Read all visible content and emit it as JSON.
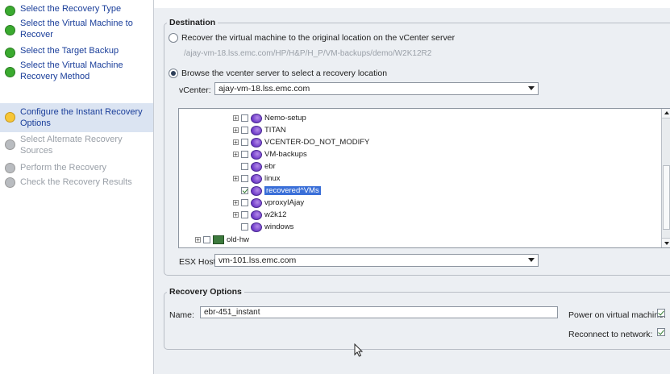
{
  "wizard": {
    "steps": [
      {
        "label": "Select the Recovery Type",
        "state": "done"
      },
      {
        "label": "Select the Virtual Machine to Recover",
        "state": "done"
      },
      {
        "label": "Select the Target Backup",
        "state": "done"
      },
      {
        "label": "Select the Virtual Machine Recovery Method",
        "state": "done"
      },
      {
        "label": "Configure the Instant Recovery Options",
        "state": "current"
      },
      {
        "label": "Select Alternate Recovery Sources",
        "state": "todo"
      },
      {
        "label": "Perform the Recovery",
        "state": "todo"
      },
      {
        "label": "Check the Recovery Results",
        "state": "todo"
      }
    ]
  },
  "destination": {
    "title": "Destination",
    "radio_original": "Recover the virtual machine to the original location on the vCenter server",
    "original_path": "/ajay-vm-18.lss.emc.com/HP/H&P/H_P/VM-backups/demo/W2K12R2",
    "radio_browse": "Browse the vcenter server to select a recovery location",
    "vcenter_label": "vCenter:",
    "vcenter_value": "ajay-vm-18.lss.emc.com",
    "tree": [
      {
        "label": "Nemo-setup",
        "expandable": true,
        "checked": false,
        "selected": false
      },
      {
        "label": "TITAN",
        "expandable": true,
        "checked": false,
        "selected": false
      },
      {
        "label": "VCENTER-DO_NOT_MODIFY",
        "expandable": true,
        "checked": false,
        "selected": false
      },
      {
        "label": "VM-backups",
        "expandable": true,
        "checked": false,
        "selected": false
      },
      {
        "label": "ebr",
        "expandable": false,
        "checked": false,
        "selected": false
      },
      {
        "label": "linux",
        "expandable": true,
        "checked": false,
        "selected": false
      },
      {
        "label": "recovered^VMs",
        "expandable": false,
        "checked": true,
        "selected": true
      },
      {
        "label": "vproxyIAjay",
        "expandable": true,
        "checked": false,
        "selected": false
      },
      {
        "label": "w2k12",
        "expandable": true,
        "checked": false,
        "selected": false
      },
      {
        "label": "windows",
        "expandable": false,
        "checked": false,
        "selected": false
      }
    ],
    "tree_host": {
      "label": "old-hw",
      "expandable": true,
      "checked": false
    },
    "esx_label": "ESX Host:",
    "esx_value": "vm-101.lss.emc.com"
  },
  "recovery": {
    "title": "Recovery Options",
    "name_label": "Name:",
    "name_value": "ebr-451_instant",
    "power_label": "Power on virtual machine:",
    "power_checked": true,
    "reconnect_label": "Reconnect to network:",
    "reconnect_checked": true
  }
}
